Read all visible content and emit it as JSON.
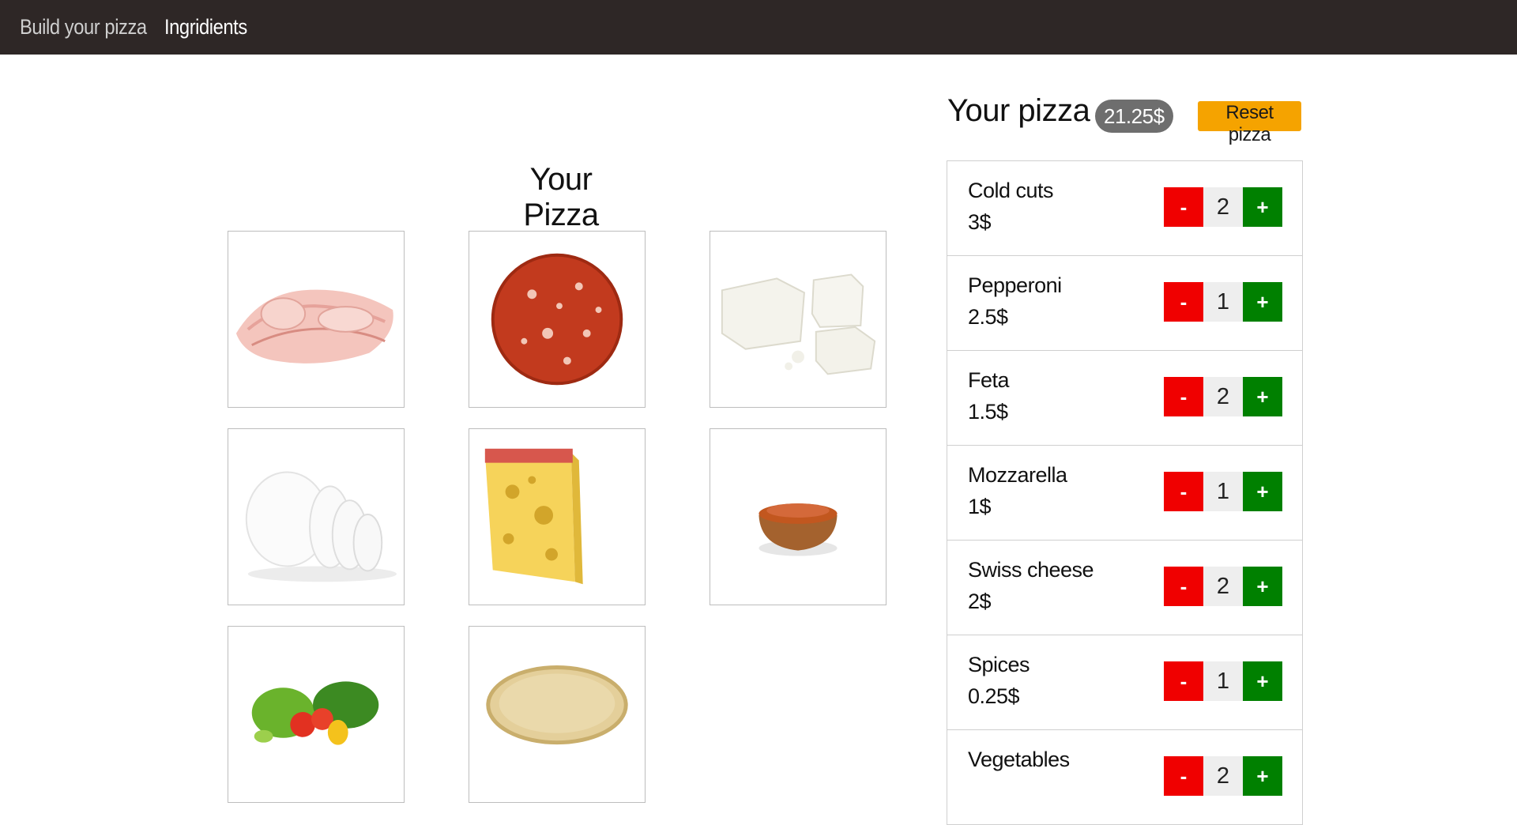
{
  "nav": {
    "brand": "Build your pizza",
    "ingredients_link": "Ingridients"
  },
  "main": {
    "title": "Your Pizza",
    "tiles": [
      {
        "icon": "cold-cuts-image"
      },
      {
        "icon": "pepperoni-image"
      },
      {
        "icon": "feta-image"
      },
      {
        "icon": "mozzarella-image"
      },
      {
        "icon": "swiss-cheese-image"
      },
      {
        "icon": "spices-image"
      },
      {
        "icon": "vegetables-image"
      },
      {
        "icon": "pizza-dough-image"
      }
    ]
  },
  "sidebar": {
    "title": "Your pizza",
    "total_price": "21.25$",
    "reset_label": "Reset pizza",
    "minus_label": "-",
    "plus_label": "+",
    "ingredients": [
      {
        "name": "Cold cuts",
        "price": "3$",
        "qty": "2"
      },
      {
        "name": "Pepperoni",
        "price": "2.5$",
        "qty": "1"
      },
      {
        "name": "Feta",
        "price": "1.5$",
        "qty": "2"
      },
      {
        "name": "Mozzarella",
        "price": "1$",
        "qty": "1"
      },
      {
        "name": "Swiss cheese",
        "price": "2$",
        "qty": "2"
      },
      {
        "name": "Spices",
        "price": "0.25$",
        "qty": "1"
      },
      {
        "name": "Vegetables",
        "price": "",
        "qty": "2"
      }
    ]
  },
  "colors": {
    "navbar": "#2e2726",
    "minus": "#f00000",
    "plus": "#008000",
    "reset": "#f5a300",
    "badge": "#6e6e6e"
  }
}
